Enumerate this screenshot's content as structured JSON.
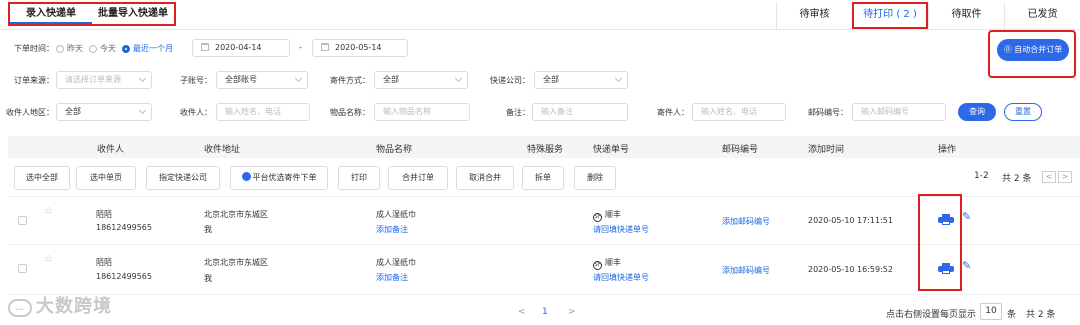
{
  "tabs_left": [
    "录入快递单",
    "批量导入快递单"
  ],
  "tabs_right": [
    "待审核",
    "待打印 ( 2 )",
    "待取件",
    "已发货"
  ],
  "filters": {
    "order_time_label": "下单时间：",
    "time_options": [
      "昨天",
      "今天",
      "最近一个月"
    ],
    "date_from": "2020-04-14",
    "date_sep": "-",
    "date_to": "2020-05-14",
    "auto_merge_button": "自动合并订单",
    "order_source_label": "订单来源：",
    "order_source_placeholder": "请选择订单来源",
    "sub_account_label": "子账号：",
    "sub_account_value": "全部账号",
    "send_method_label": "寄件方式：",
    "send_method_value": "全部",
    "courier_label": "快递公司：",
    "courier_value": "全部",
    "region_label": "收件人地区：",
    "region_value": "全部",
    "recipient_label": "收件人：",
    "recipient_placeholder": "输入姓名、电话",
    "item_name_label": "物品名称：",
    "item_name_placeholder": "输入物品名称",
    "remark_label": "备注：",
    "remark_placeholder": "输入备注",
    "sender_label": "寄件人：",
    "sender_placeholder": "输入姓名、电话",
    "postal_label": "邮码编号：",
    "postal_placeholder": "输入邮码编号",
    "query_button": "查询",
    "reset_button": "重置"
  },
  "table_headers": [
    "收件人",
    "收件地址",
    "物品名称",
    "特殊服务",
    "快递单号",
    "邮码编号",
    "添加时间",
    "操作"
  ],
  "actions": [
    "选中全部",
    "选中单页",
    "指定快递公司",
    "平台优选寄件下单",
    "打印",
    "合并订单",
    "取消合并",
    "拆单",
    "删除"
  ],
  "page_summary": {
    "range": "1-2",
    "total": "共 2 条",
    "prev": "<",
    "next": ">"
  },
  "rows": [
    {
      "name": "陌陌",
      "phone": "18612499565",
      "address": "北京北京市东城区",
      "address2": "我",
      "item": "成人湿纸巾",
      "add_remark": "添加备注",
      "courier": "顺丰",
      "courier_badge": "SF",
      "fill_tracking": "请回填快递单号",
      "add_postal": "添加邮码编号",
      "time": "2020-05-10 17:11:51"
    },
    {
      "name": "陌陌",
      "phone": "18612499565",
      "address": "北京北京市东城区",
      "address2": "我",
      "item": "成人湿纸巾",
      "add_remark": "添加备注",
      "courier": "顺丰",
      "courier_badge": "SF",
      "fill_tracking": "请回填快递单号",
      "add_postal": "添加邮码编号",
      "time": "2020-05-10 16:59:52"
    }
  ],
  "footer": {
    "logo_text": "大数跨境",
    "prev": "<",
    "current_page": "1",
    "next": ">",
    "page_size_label": "点击右侧设置每页显示",
    "page_size": "10",
    "page_size_unit": "条",
    "total": "共 2 条"
  },
  "icons": {
    "checkbox": "checkbox-icon",
    "star": "star-icon",
    "print": "print-icon",
    "edit": "edit-icon",
    "calendar": "calendar-icon",
    "chevron": "chevron-down-icon"
  },
  "colors": {
    "accent": "#2d69e6",
    "highlight": "#e02020",
    "link": "#1a66e6"
  }
}
